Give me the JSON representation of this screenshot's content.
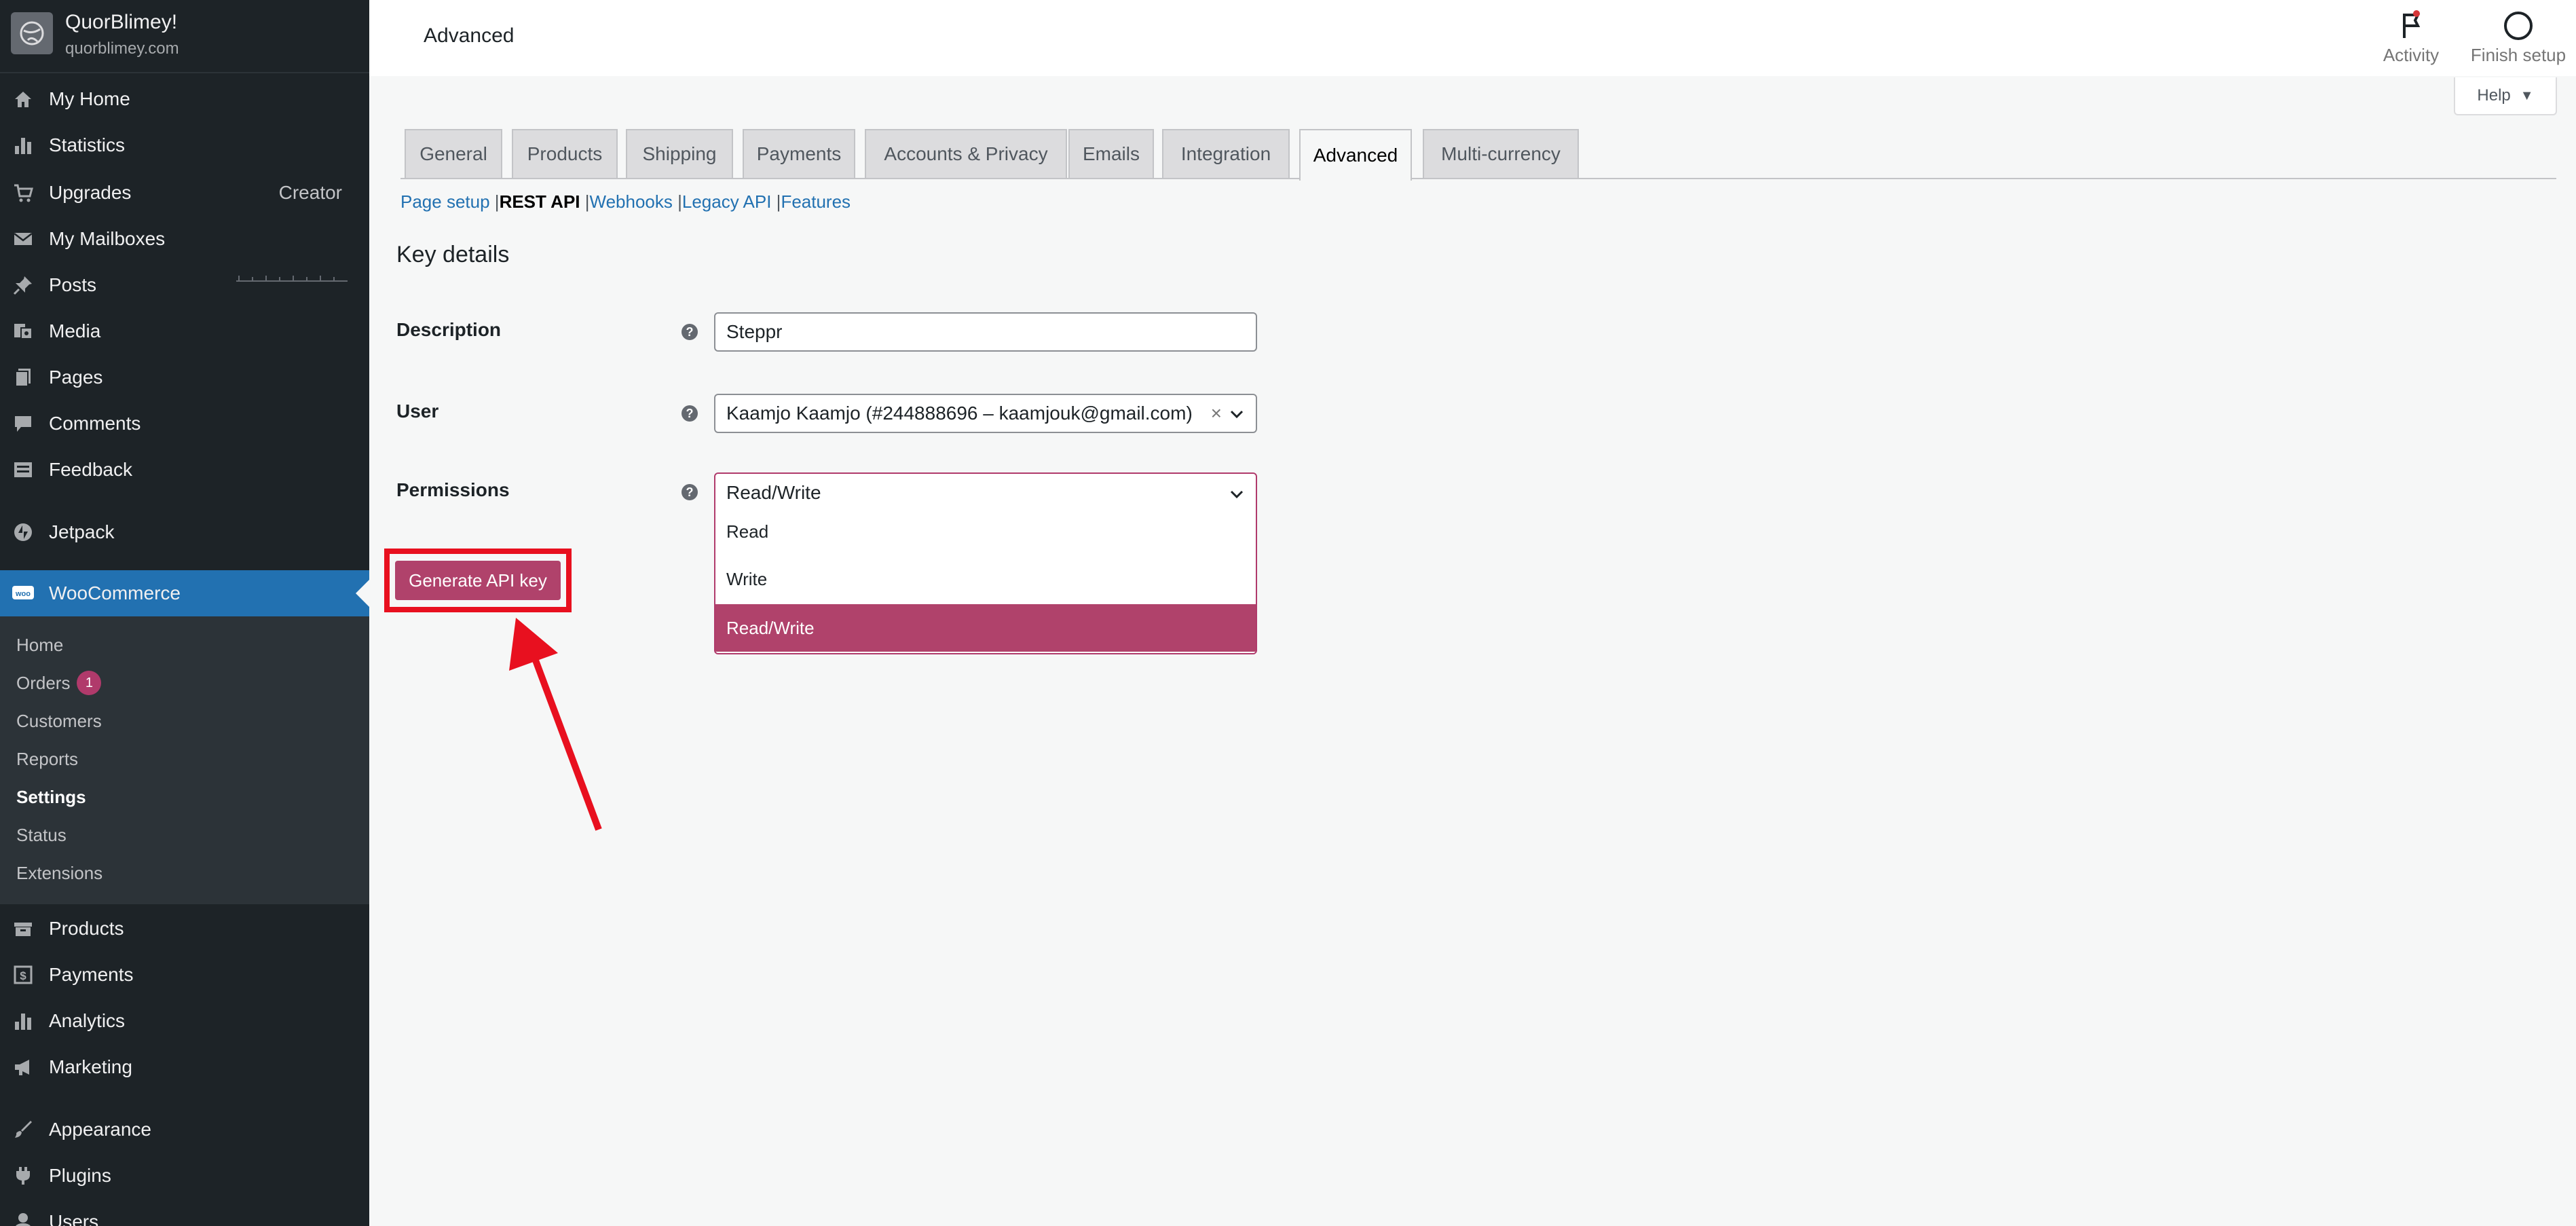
{
  "site": {
    "name": "QuorBlimey!",
    "url": "quorblimey.com"
  },
  "sidebar": {
    "items": [
      {
        "label": "My Home",
        "icon": "home-icon"
      },
      {
        "label": "Statistics",
        "icon": "bar-chart-icon"
      },
      {
        "label": "Upgrades",
        "icon": "cart-icon",
        "right": "Creator"
      },
      {
        "label": "My Mailboxes",
        "icon": "mail-icon"
      },
      {
        "label": "Posts",
        "icon": "pin-icon"
      },
      {
        "label": "Media",
        "icon": "media-icon"
      },
      {
        "label": "Pages",
        "icon": "pages-icon"
      },
      {
        "label": "Comments",
        "icon": "comment-icon"
      },
      {
        "label": "Feedback",
        "icon": "feedback-icon"
      },
      {
        "label": "Jetpack",
        "icon": "jetpack-icon"
      },
      {
        "label": "WooCommerce",
        "icon": "woo-icon"
      },
      {
        "label": "Products",
        "icon": "products-icon"
      },
      {
        "label": "Payments",
        "icon": "dollar-icon"
      },
      {
        "label": "Analytics",
        "icon": "analytics-icon"
      },
      {
        "label": "Marketing",
        "icon": "megaphone-icon"
      },
      {
        "label": "Appearance",
        "icon": "brush-icon"
      },
      {
        "label": "Plugins",
        "icon": "plugin-icon"
      },
      {
        "label": "Users",
        "icon": "user-icon"
      }
    ],
    "woo_submenu": [
      {
        "label": "Home"
      },
      {
        "label": "Orders",
        "badge": "1"
      },
      {
        "label": "Customers"
      },
      {
        "label": "Reports"
      },
      {
        "label": "Settings"
      },
      {
        "label": "Status"
      },
      {
        "label": "Extensions"
      }
    ]
  },
  "topbar": {
    "title": "Advanced",
    "activity_label": "Activity",
    "finish_label": "Finish setup",
    "help_label": "Help"
  },
  "tabs": [
    {
      "label": "General"
    },
    {
      "label": "Products"
    },
    {
      "label": "Shipping"
    },
    {
      "label": "Payments"
    },
    {
      "label": "Accounts & Privacy"
    },
    {
      "label": "Emails"
    },
    {
      "label": "Integration"
    },
    {
      "label": "Advanced"
    },
    {
      "label": "Multi-currency"
    }
  ],
  "subnav": {
    "items": [
      {
        "label": "Page setup"
      },
      {
        "label": "REST API"
      },
      {
        "label": "Webhooks"
      },
      {
        "label": "Legacy API"
      },
      {
        "label": "Features"
      }
    ],
    "separator": "|"
  },
  "form": {
    "section_title": "Key details",
    "description_label": "Description",
    "description_value": "Steppr",
    "user_label": "User",
    "user_value": "Kaamjo Kaamjo (#244888696 – kaamjouk@gmail.com)",
    "clear_symbol": "×",
    "permissions_label": "Permissions",
    "permissions_value": "Read/Write",
    "permission_options": [
      "Read",
      "Write",
      "Read/Write"
    ],
    "help_symbol": "?",
    "generate_label": "Generate API key"
  },
  "colors": {
    "sidebar_bg": "#1d2327",
    "active_blue": "#2271b1",
    "woo_accent": "#b0426b",
    "annotation_red": "#e8101f"
  }
}
